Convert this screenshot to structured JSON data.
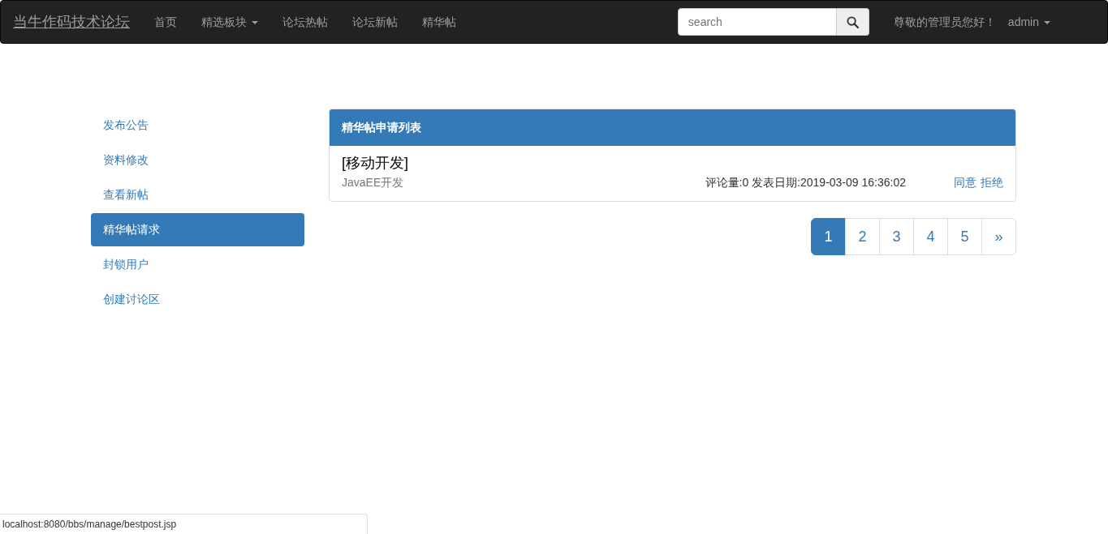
{
  "navbar": {
    "brand": "当牛作码技术论坛",
    "items": [
      {
        "label": "首页",
        "kind": "link"
      },
      {
        "label": "精选板块",
        "kind": "dropdown"
      },
      {
        "label": "论坛热帖",
        "kind": "link"
      },
      {
        "label": "论坛新帖",
        "kind": "link"
      },
      {
        "label": "精华帖",
        "kind": "link"
      }
    ],
    "search": {
      "placeholder": "search"
    },
    "greeting": "尊敬的管理员您好！",
    "user": "admin"
  },
  "sidebar": {
    "items": [
      {
        "label": "发布公告",
        "selected": false
      },
      {
        "label": "资料修改",
        "selected": false
      },
      {
        "label": "查看新帖",
        "selected": false
      },
      {
        "label": "精华帖请求",
        "selected": true
      },
      {
        "label": "封锁用户",
        "selected": false
      },
      {
        "label": "创建讨论区",
        "selected": false
      }
    ]
  },
  "panel": {
    "title": "精华帖申请列表",
    "posts": [
      {
        "title": "[移动开发]",
        "board": "JavaEE开发",
        "meta": "评论量:0 发表日期:2019-03-09 16:36:02",
        "actions": [
          "同意",
          "拒绝"
        ]
      }
    ]
  },
  "pagination": [
    {
      "label": "1",
      "selected": true
    },
    {
      "label": "2",
      "selected": false
    },
    {
      "label": "3",
      "selected": false
    },
    {
      "label": "4",
      "selected": false
    },
    {
      "label": "5",
      "selected": false
    },
    {
      "label": "»",
      "selected": false
    }
  ],
  "status_bar": "localhost:8080/bbs/manage/bestpost.jsp"
}
